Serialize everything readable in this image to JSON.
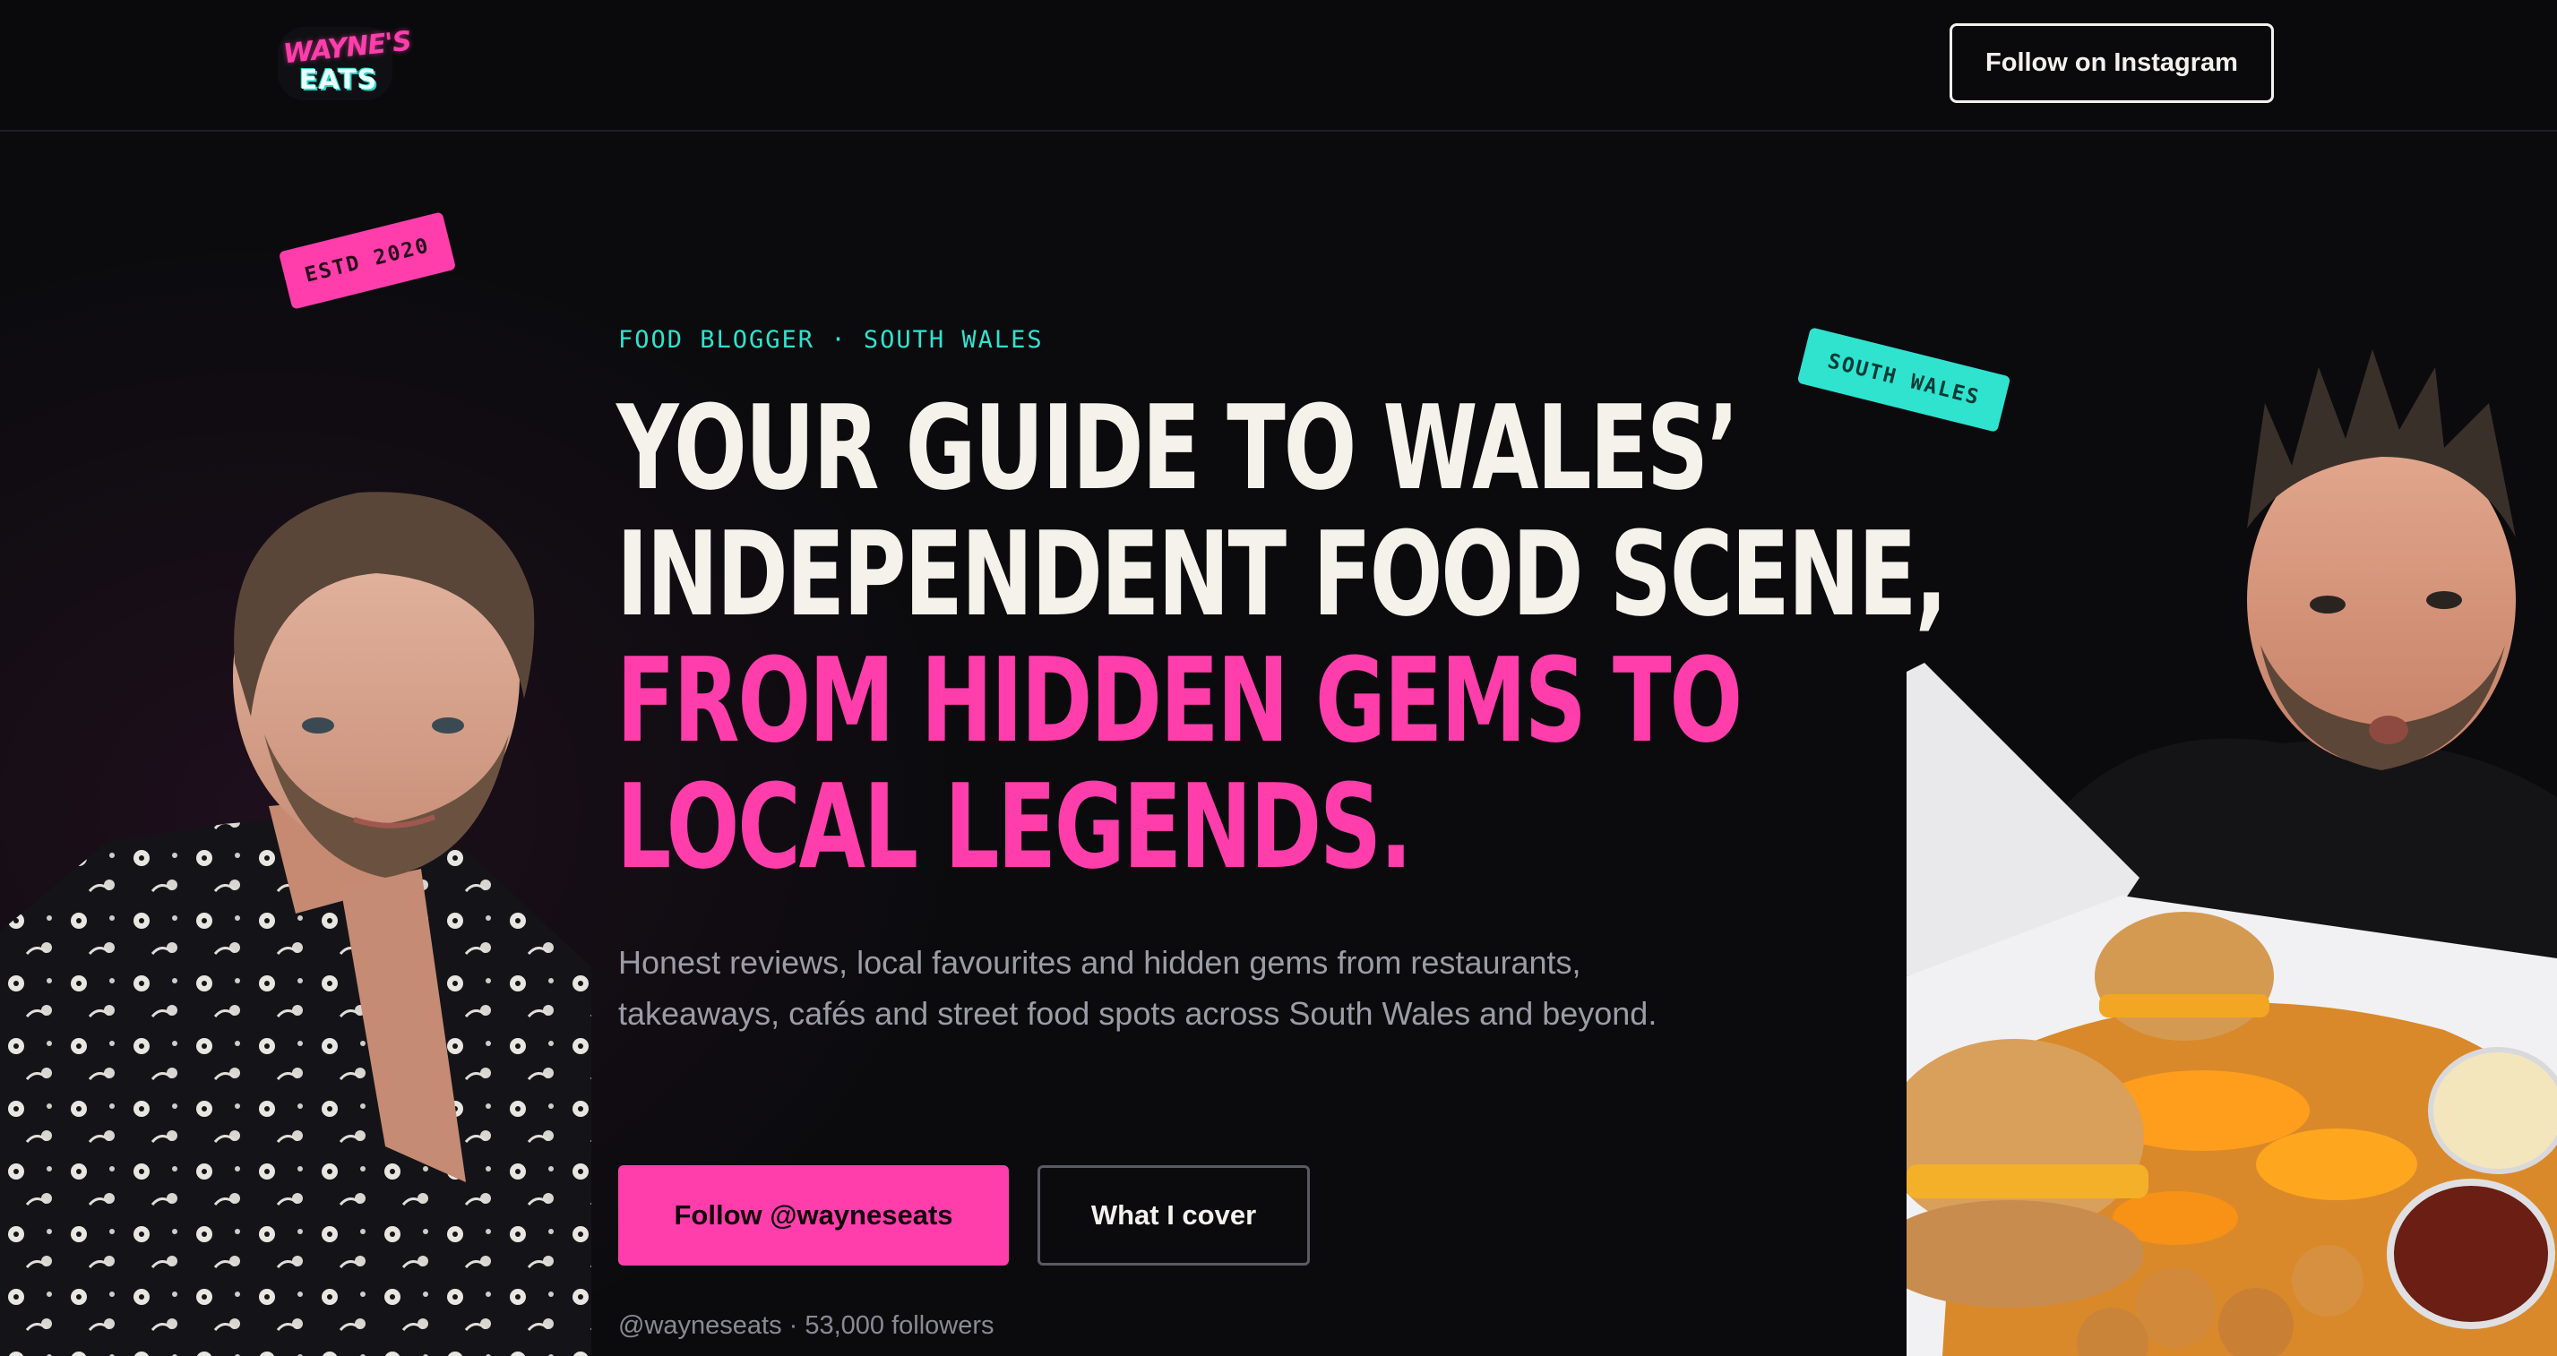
{
  "header": {
    "logo_top": "WAYNE'S",
    "logo_bottom": "EATS",
    "instagram_button": "Follow on Instagram"
  },
  "stickers": {
    "established": "ESTD 2020",
    "region": "SOUTH WALES"
  },
  "hero": {
    "eyebrow": "FOOD BLOGGER · SOUTH WALES",
    "headline_line1": "YOUR GUIDE TO WALES’",
    "headline_line2": "INDEPENDENT FOOD SCENE,",
    "headline_line3": "FROM HIDDEN GEMS TO",
    "headline_line4": "LOCAL LEGENDS.",
    "intro": "Honest reviews, local favourites and hidden gems from restaurants, takeaways, cafés and street food spots across South Wales and beyond.",
    "primary_button": "Follow @wayneseats",
    "secondary_button": "What I cover",
    "followers_line": "@wayneseats · 53,000 followers"
  },
  "colors": {
    "accent_pink": "#ff3eab",
    "accent_teal": "#2fe3cf",
    "background": "#0b0b0e",
    "text_light": "#f4f2ea"
  },
  "images": {
    "left_portrait": "portrait-photo-floral-shirt",
    "right_portrait": "portrait-photo-with-burger-box"
  }
}
